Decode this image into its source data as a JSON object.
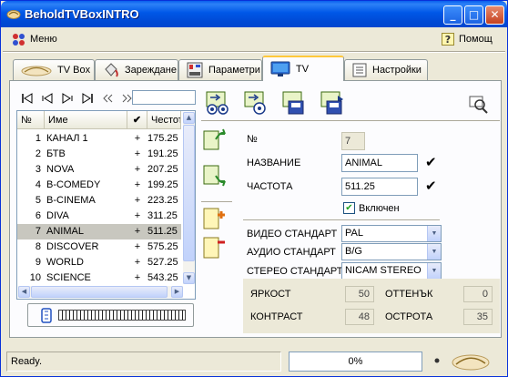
{
  "window": {
    "title": "BeholdTVBoxINTRO",
    "min_label": "_",
    "max_label": "□",
    "close_label": "✕"
  },
  "menu": {
    "main": "Меню",
    "help": "Помощ"
  },
  "tabs": [
    {
      "label": "TV Box"
    },
    {
      "label": "Зареждане"
    },
    {
      "label": "Параметри"
    },
    {
      "label": "TV"
    },
    {
      "label": "Настройки"
    }
  ],
  "active_tab": "TV",
  "channel_list": {
    "headers": {
      "num": "№",
      "name": "Име",
      "enabled": "✔",
      "freq": "Честота"
    },
    "rows": [
      {
        "num": "1",
        "name": "КАНАЛ 1",
        "enabled": "+",
        "freq": "175.25"
      },
      {
        "num": "2",
        "name": "БТВ",
        "enabled": "+",
        "freq": "191.25"
      },
      {
        "num": "3",
        "name": "NOVA",
        "enabled": "+",
        "freq": "207.25"
      },
      {
        "num": "4",
        "name": "B-COMEDY",
        "enabled": "+",
        "freq": "199.25"
      },
      {
        "num": "5",
        "name": "B-CINEMA",
        "enabled": "+",
        "freq": "223.25"
      },
      {
        "num": "6",
        "name": "DIVA",
        "enabled": "+",
        "freq": "311.25"
      },
      {
        "num": "7",
        "name": "ANIMAL",
        "enabled": "+",
        "freq": "511.25"
      },
      {
        "num": "8",
        "name": "DISCOVER",
        "enabled": "+",
        "freq": "575.25"
      },
      {
        "num": "9",
        "name": "WORLD",
        "enabled": "+",
        "freq": "527.25"
      },
      {
        "num": "10",
        "name": "SCIENCE",
        "enabled": "+",
        "freq": "543.25"
      }
    ],
    "selected_num": "7"
  },
  "details": {
    "num_label": "№",
    "num_value": "7",
    "name_label": "НАЗВАНИЕ",
    "name_value": "ANIMAL",
    "freq_label": "ЧАСТОТА",
    "freq_value": "511.25",
    "enabled_label": "Включен",
    "enabled_checked": true,
    "video_std_label": "ВИДЕО СТАНДАРТ",
    "video_std_value": "PAL",
    "audio_std_label": "АУДИО СТАНДАРТ",
    "audio_std_value": "B/G",
    "stereo_std_label": "СТЕРЕО СТАНДАРТ",
    "stereo_std_value": "NICAM STEREO"
  },
  "picture": {
    "brightness_label": "ЯРКОСТ",
    "brightness_value": "50",
    "hue_label": "ОТТЕНЪК",
    "hue_value": "0",
    "contrast_label": "КОНТРАСТ",
    "contrast_value": "48",
    "sharpness_label": "ОСТРОТА",
    "sharpness_value": "35"
  },
  "status": {
    "text": "Ready.",
    "progress_text": "0%"
  },
  "colors": {
    "titlebar": "#0057e7",
    "accent_tab": "#ffc83c",
    "selection": "#c8c7bf",
    "check_green": "#21a121"
  }
}
